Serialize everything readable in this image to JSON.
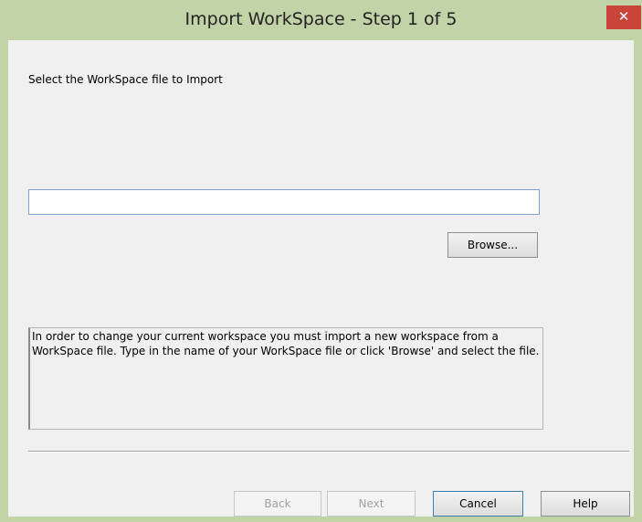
{
  "window": {
    "title": "Import WorkSpace - Step 1 of 5",
    "close_glyph": "✕"
  },
  "main": {
    "prompt_label": "Select the WorkSpace file to Import",
    "file_path_value": "",
    "browse_label": "Browse...",
    "info_text": "In order to change your current workspace you must import a new workspace from a WorkSpace file. Type in the name of your WorkSpace file or click 'Browse' and select the file."
  },
  "footer": {
    "back_label": "Back",
    "next_label": "Next",
    "cancel_label": "Cancel",
    "help_label": "Help"
  },
  "colors": {
    "frame": "#c2d3a7",
    "close": "#c9453a",
    "dialog_bg": "#f0f0f0",
    "input_border": "#7da2ce",
    "default_button_border": "#3c7fb1"
  }
}
